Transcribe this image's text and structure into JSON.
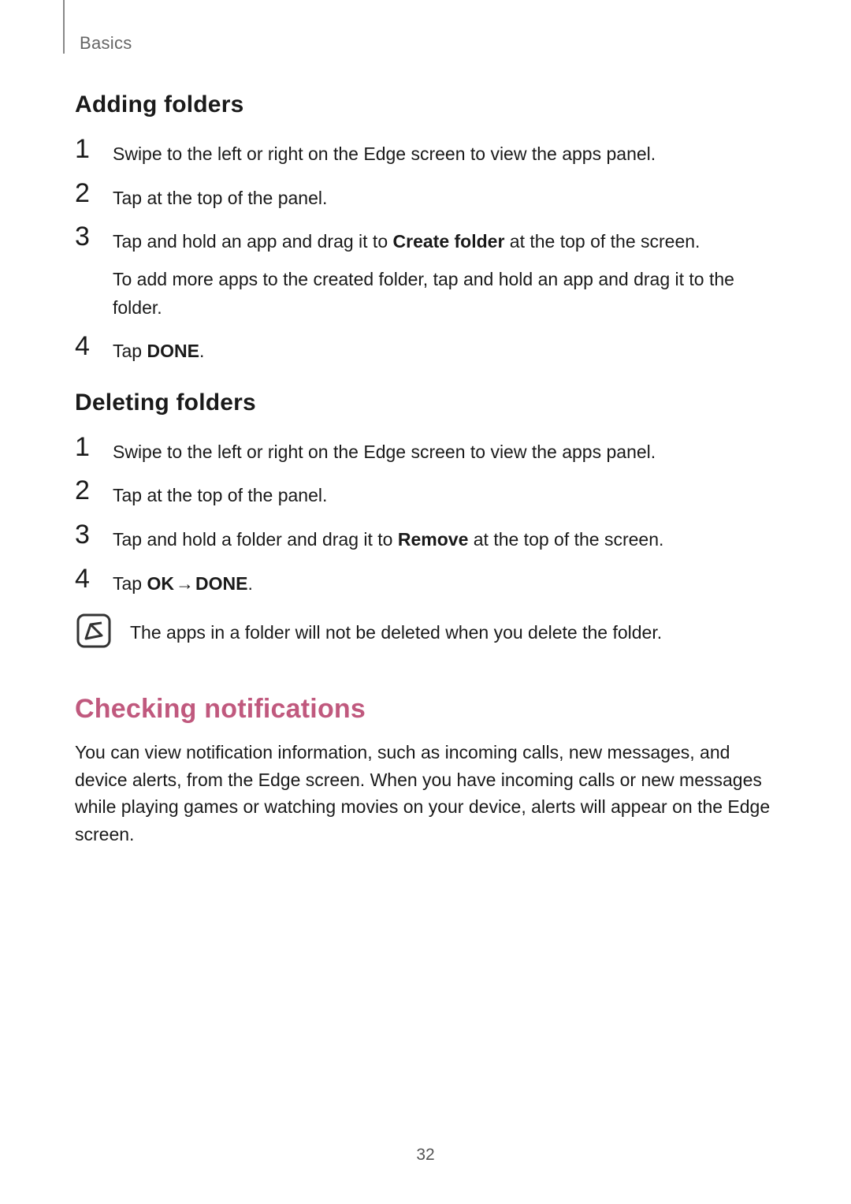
{
  "breadcrumb": "Basics",
  "sections": {
    "adding": {
      "title": "Adding folders",
      "steps": {
        "s1": "Swipe to the left or right on the Edge screen to view the apps panel.",
        "s2_pre": "Tap ",
        "s2_post": " at the top of the panel.",
        "s3_pre": "Tap and hold an app and drag it to ",
        "s3_bold": "Create folder",
        "s3_post": " at the top of the screen.",
        "s3_sub": "To add more apps to the created folder, tap and hold an app and drag it to the folder.",
        "s4_pre": "Tap ",
        "s4_bold": "DONE",
        "s4_post": "."
      }
    },
    "deleting": {
      "title": "Deleting folders",
      "steps": {
        "s1": "Swipe to the left or right on the Edge screen to view the apps panel.",
        "s2_pre": "Tap ",
        "s2_post": " at the top of the panel.",
        "s3_pre": "Tap and hold a folder and drag it to ",
        "s3_bold": "Remove",
        "s3_post": " at the top of the screen.",
        "s4_pre": "Tap ",
        "s4_bold1": "OK",
        "s4_arrow": " → ",
        "s4_bold2": "DONE",
        "s4_post": "."
      },
      "note": "The apps in a folder will not be deleted when you delete the folder."
    },
    "checking": {
      "title": "Checking notifications",
      "body": "You can view notification information, such as incoming calls, new messages, and device alerts, from the Edge screen. When you have incoming calls or new messages while playing games or watching movies on your device, alerts will appear on the Edge screen."
    }
  },
  "nums": {
    "n1": "1",
    "n2": "2",
    "n3": "3",
    "n4": "4"
  },
  "page_number": "32"
}
